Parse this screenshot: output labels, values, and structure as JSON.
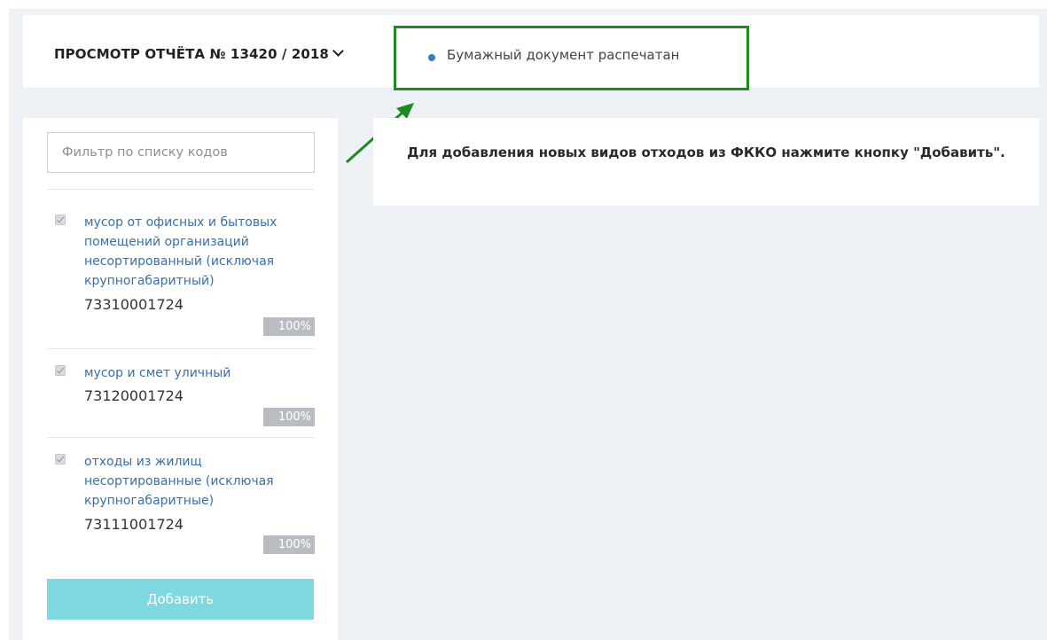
{
  "header": {
    "report_title": "ПРОСМОТР ОТЧЁТА № 13420 / 2018",
    "status_text": "Бумажный документ распечатан"
  },
  "sidebar": {
    "filter_placeholder": "Фильтр по списку кодов",
    "items": [
      {
        "name": "мусор от офисных и бытовых помещений организаций несортированный (исключая крупногабаритный)",
        "code": "73310001724",
        "percent": "100%",
        "checked": true
      },
      {
        "name": "мусор и смет уличный",
        "code": "73120001724",
        "percent": "100%",
        "checked": true
      },
      {
        "name": "отходы из жилищ несортированные (исключая крупногабаритные)",
        "code": "73111001724",
        "percent": "100%",
        "checked": true
      }
    ],
    "add_label": "Добавить"
  },
  "info": {
    "message": "Для добавления новых видов отходов из ФККО нажмите кнопку \"Добавить\"."
  },
  "colors": {
    "highlight_border": "#1f8a1f",
    "status_dot": "#3a78c9",
    "add_button": "#7fd7df",
    "item_link": "#3b6fa8"
  }
}
